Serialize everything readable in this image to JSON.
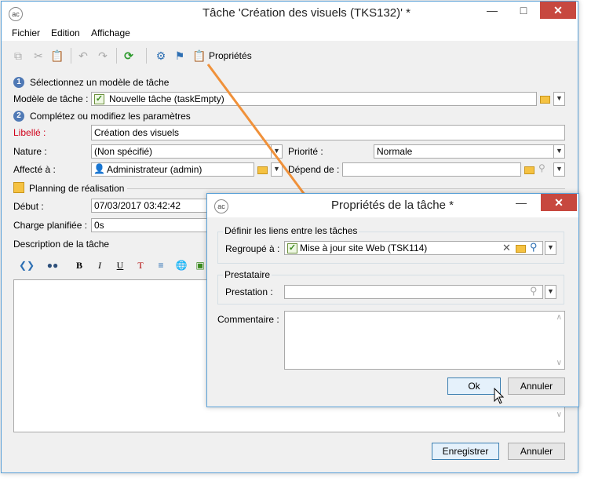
{
  "main_window": {
    "title": "Tâche 'Création des visuels (TKS132)' *",
    "menu": [
      "Fichier",
      "Edition",
      "Affichage"
    ],
    "toolbar_properties_label": "Propriétés",
    "step1_label": "Sélectionnez un modèle de tâche",
    "model_label": "Modèle de tâche :",
    "model_value": "Nouvelle tâche (taskEmpty)",
    "step2_label": "Complétez ou modifiez les paramètres",
    "libelle_label": "Libellé :",
    "libelle_value": "Création des visuels",
    "nature_label": "Nature :",
    "nature_value": "(Non spécifié)",
    "priorite_label": "Priorité :",
    "priorite_value": "Normale",
    "affecte_label": "Affecté à :",
    "affecte_value": "Administrateur (admin)",
    "depend_label": "Dépend de :",
    "depend_value": "",
    "planning_label": "Planning de réalisation",
    "debut_label": "Début :",
    "debut_value": "07/03/2017 03:42:42",
    "charge_label": "Charge planifiée :",
    "charge_value": "0s",
    "description_label": "Description de la tâche",
    "save_button": "Enregistrer",
    "cancel_button": "Annuler",
    "step1_number": "1",
    "step2_number": "2"
  },
  "dialog": {
    "title": "Propriétés de la tâche *",
    "links_group": "Définir les liens entre les tâches",
    "regroupe_label": "Regroupé à :",
    "regroupe_value": "Mise à jour site Web (TSK114)",
    "prestataire_group": "Prestataire",
    "prestation_label": "Prestation :",
    "prestation_value": "",
    "commentaire_label": "Commentaire :",
    "ok_button": "Ok",
    "cancel_button": "Annuler"
  },
  "colors": {
    "accent": "#3c7fb1",
    "close": "#c7483f",
    "required": "#d0021b",
    "arrow": "#f0913a"
  }
}
